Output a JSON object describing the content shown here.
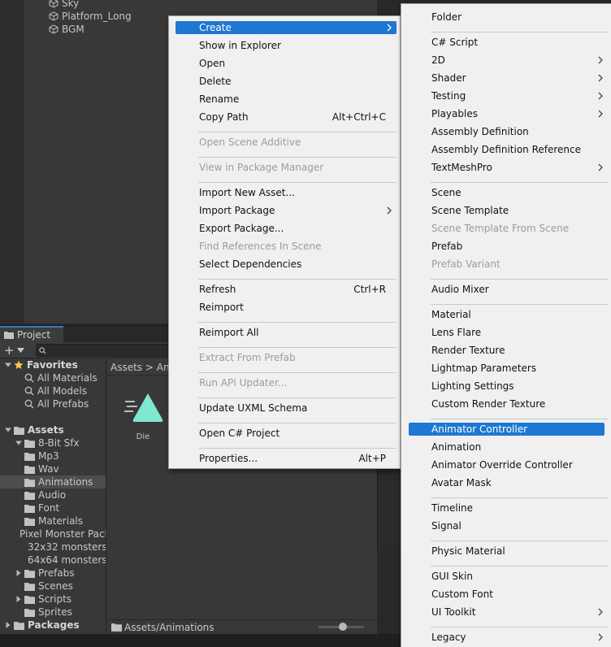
{
  "hierarchy": {
    "items": [
      "Sky",
      "Platform_Long",
      "BGM"
    ]
  },
  "project": {
    "tab_label": "Project",
    "add_label": "+",
    "search_placeholder": "",
    "breadcrumb": "Assets > Ani",
    "status_path": "Assets/Animations",
    "tree": [
      {
        "label": "Favorites",
        "bold": true,
        "indent": 0,
        "kind": "star",
        "arrow": "down"
      },
      {
        "label": "All Materials",
        "indent": 2,
        "kind": "search"
      },
      {
        "label": "All Models",
        "indent": 2,
        "kind": "search"
      },
      {
        "label": "All Prefabs",
        "indent": 2,
        "kind": "search"
      },
      {
        "label": "",
        "indent": 0,
        "kind": "blank"
      },
      {
        "label": "Assets",
        "bold": true,
        "indent": 0,
        "kind": "folder",
        "arrow": "down"
      },
      {
        "label": "8-Bit Sfx",
        "indent": 1,
        "kind": "folder",
        "arrow": "down"
      },
      {
        "label": "Mp3",
        "indent": 2,
        "kind": "folder"
      },
      {
        "label": "Wav",
        "indent": 2,
        "kind": "folder"
      },
      {
        "label": "Animations",
        "indent": 1,
        "kind": "folder",
        "selected": true
      },
      {
        "label": "Audio",
        "indent": 1,
        "kind": "folder"
      },
      {
        "label": "Font",
        "indent": 1,
        "kind": "folder"
      },
      {
        "label": "Materials",
        "indent": 1,
        "kind": "folder"
      },
      {
        "label": "Pixel Monster Pack",
        "indent": 1,
        "kind": "folder",
        "arrow": "down"
      },
      {
        "label": "32x32 monsters",
        "indent": 2,
        "kind": "folder"
      },
      {
        "label": "64x64 monsters",
        "indent": 2,
        "kind": "folder"
      },
      {
        "label": "Prefabs",
        "indent": 1,
        "kind": "folder",
        "arrow": "right"
      },
      {
        "label": "Scenes",
        "indent": 1,
        "kind": "folder"
      },
      {
        "label": "Scripts",
        "indent": 1,
        "kind": "folder",
        "arrow": "right"
      },
      {
        "label": "Sprites",
        "indent": 1,
        "kind": "folder"
      },
      {
        "label": "Packages",
        "bold": true,
        "indent": 0,
        "kind": "folder",
        "arrow": "right"
      }
    ],
    "assets": [
      {
        "label": "Die",
        "icon": "animation-clip-icon"
      }
    ]
  },
  "menu1": [
    {
      "label": "Create",
      "highlighted": true,
      "submenu": true
    },
    {
      "label": "Show in Explorer"
    },
    {
      "label": "Open"
    },
    {
      "label": "Delete"
    },
    {
      "label": "Rename"
    },
    {
      "label": "Copy Path",
      "shortcut": "Alt+Ctrl+C"
    },
    {
      "sep": true
    },
    {
      "label": "Open Scene Additive",
      "disabled": true
    },
    {
      "sep": true
    },
    {
      "label": "View in Package Manager",
      "disabled": true
    },
    {
      "sep": true
    },
    {
      "label": "Import New Asset..."
    },
    {
      "label": "Import Package",
      "submenu": true
    },
    {
      "label": "Export Package..."
    },
    {
      "label": "Find References In Scene",
      "disabled": true
    },
    {
      "label": "Select Dependencies"
    },
    {
      "sep": true
    },
    {
      "label": "Refresh",
      "shortcut": "Ctrl+R"
    },
    {
      "label": "Reimport"
    },
    {
      "sep": true
    },
    {
      "label": "Reimport All"
    },
    {
      "sep": true
    },
    {
      "label": "Extract From Prefab",
      "disabled": true
    },
    {
      "sep": true
    },
    {
      "label": "Run API Updater...",
      "disabled": true
    },
    {
      "sep": true
    },
    {
      "label": "Update UXML Schema"
    },
    {
      "sep": true
    },
    {
      "label": "Open C# Project"
    },
    {
      "sep": true
    },
    {
      "label": "Properties...",
      "shortcut": "Alt+P"
    }
  ],
  "menu2": [
    {
      "label": "Folder"
    },
    {
      "sep": true
    },
    {
      "label": "C# Script"
    },
    {
      "label": "2D",
      "submenu": true
    },
    {
      "label": "Shader",
      "submenu": true
    },
    {
      "label": "Testing",
      "submenu": true
    },
    {
      "label": "Playables",
      "submenu": true
    },
    {
      "label": "Assembly Definition"
    },
    {
      "label": "Assembly Definition Reference"
    },
    {
      "label": "TextMeshPro",
      "submenu": true
    },
    {
      "sep": true
    },
    {
      "label": "Scene"
    },
    {
      "label": "Scene Template"
    },
    {
      "label": "Scene Template From Scene",
      "disabled": true
    },
    {
      "label": "Prefab"
    },
    {
      "label": "Prefab Variant",
      "disabled": true
    },
    {
      "sep": true
    },
    {
      "label": "Audio Mixer"
    },
    {
      "sep": true
    },
    {
      "label": "Material"
    },
    {
      "label": "Lens Flare"
    },
    {
      "label": "Render Texture"
    },
    {
      "label": "Lightmap Parameters"
    },
    {
      "label": "Lighting Settings"
    },
    {
      "label": "Custom Render Texture"
    },
    {
      "sep": true
    },
    {
      "label": "Animator Controller",
      "highlighted": true
    },
    {
      "label": "Animation"
    },
    {
      "label": "Animator Override Controller"
    },
    {
      "label": "Avatar Mask"
    },
    {
      "sep": true
    },
    {
      "label": "Timeline"
    },
    {
      "label": "Signal"
    },
    {
      "sep": true
    },
    {
      "label": "Physic Material"
    },
    {
      "sep": true
    },
    {
      "label": "GUI Skin"
    },
    {
      "label": "Custom Font"
    },
    {
      "label": "UI Toolkit",
      "submenu": true
    },
    {
      "sep": true
    },
    {
      "label": "Legacy",
      "submenu": true
    }
  ],
  "colors": {
    "highlight": "#1e78d2",
    "menu_bg": "#f0f0f0",
    "disabled_text": "#9c9c9c",
    "panel_bg": "#383838",
    "selected_row": "#4d4d4d",
    "tab_accent": "#3a79bb",
    "folder": "#c2c2c2",
    "favorite_star": "#f2c84b",
    "anim_icon": "#7fe7d2"
  }
}
